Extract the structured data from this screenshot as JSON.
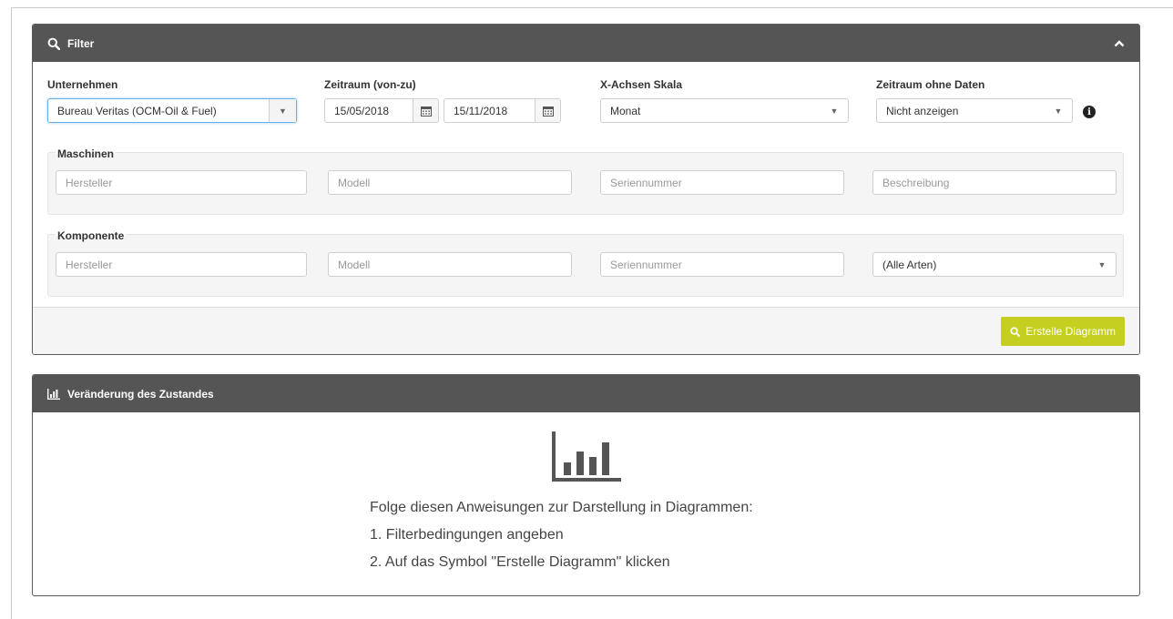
{
  "filter": {
    "title": "Filter",
    "company": {
      "label": "Unternehmen",
      "value": "Bureau Veritas (OCM-Oil & Fuel)"
    },
    "period": {
      "label": "Zeitraum (von-zu)",
      "from": "15/05/2018",
      "to": "15/11/2018"
    },
    "xaxis": {
      "label": "X-Achsen Skala",
      "value": "Monat"
    },
    "empty_period": {
      "label": "Zeitraum ohne Daten",
      "value": "Nicht anzeigen"
    },
    "machines": {
      "legend": "Maschinen",
      "manufacturer_placeholder": "Hersteller",
      "model_placeholder": "Modell",
      "serial_placeholder": "Seriennummer",
      "description_placeholder": "Beschreibung"
    },
    "component": {
      "legend": "Komponente",
      "manufacturer_placeholder": "Hersteller",
      "model_placeholder": "Modell",
      "serial_placeholder": "Seriennummer",
      "type_value": "(Alle Arten)"
    },
    "create_button": "Erstelle Diagramm"
  },
  "chart_panel": {
    "title": "Veränderung des Zustandes",
    "instructions": {
      "heading": "Folge diesen Anweisungen zur Darstellung in Diagrammen:",
      "step1": "1. Filterbedingungen angeben",
      "step2": "2. Auf das Symbol \"Erstelle Diagramm\" klicken"
    }
  },
  "colors": {
    "header_bg": "#555555",
    "accent_button": "#c4cf1f",
    "focus_border": "#66afe9"
  },
  "icons": {
    "filter_header": "search-icon",
    "collapse": "chevron-up-icon",
    "calendar": "calendar-icon",
    "info": "info-icon",
    "chart_header": "bar-chart-icon",
    "chart_placeholder": "bar-chart-icon"
  }
}
